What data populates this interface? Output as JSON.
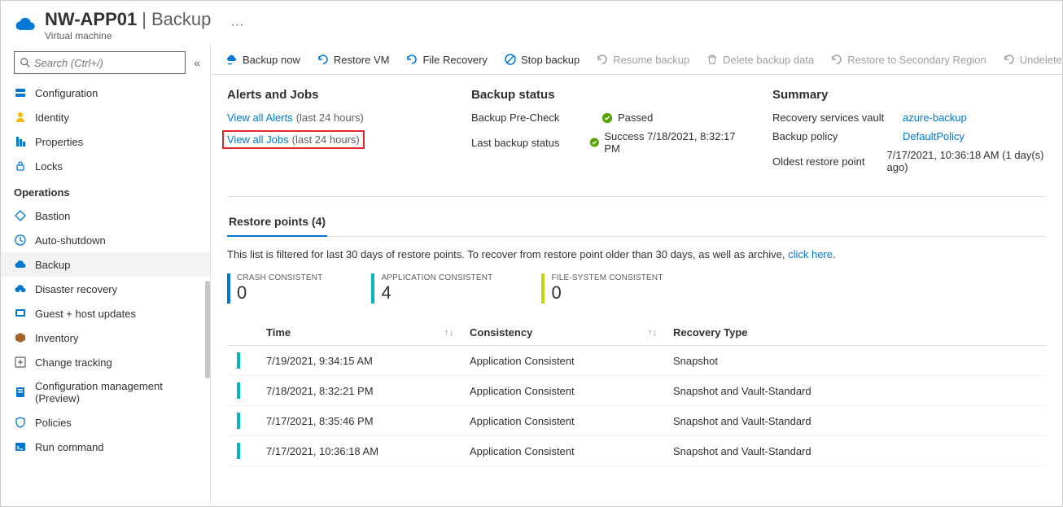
{
  "header": {
    "vm_name": "NW-APP01",
    "section": "Backup",
    "subtitle": "Virtual machine",
    "more": "···"
  },
  "sidebar": {
    "search_placeholder": "Search (Ctrl+/)",
    "items1": [
      {
        "label": "Configuration"
      },
      {
        "label": "Identity"
      },
      {
        "label": "Properties"
      },
      {
        "label": "Locks"
      }
    ],
    "section_label": "Operations",
    "items2": [
      {
        "label": "Bastion"
      },
      {
        "label": "Auto-shutdown"
      },
      {
        "label": "Backup"
      },
      {
        "label": "Disaster recovery"
      },
      {
        "label": "Guest + host updates"
      },
      {
        "label": "Inventory"
      },
      {
        "label": "Change tracking"
      },
      {
        "label": "Configuration management (Preview)"
      },
      {
        "label": "Policies"
      },
      {
        "label": "Run command"
      }
    ]
  },
  "toolbar": {
    "backup_now": "Backup now",
    "restore_vm": "Restore VM",
    "file_recovery": "File Recovery",
    "stop_backup": "Stop backup",
    "resume_backup": "Resume backup",
    "delete_backup": "Delete backup data",
    "restore_secondary": "Restore to Secondary Region",
    "undelete": "Undelete"
  },
  "alerts": {
    "title": "Alerts and Jobs",
    "view_alerts": "View all Alerts",
    "view_alerts_suffix": "(last 24 hours)",
    "view_jobs": "View all Jobs",
    "view_jobs_suffix": "(last 24 hours)"
  },
  "backup_status": {
    "title": "Backup status",
    "precheck_label": "Backup Pre-Check",
    "precheck_value": "Passed",
    "last_label": "Last backup status",
    "last_value": "Success 7/18/2021, 8:32:17 PM"
  },
  "summary": {
    "title": "Summary",
    "vault_label": "Recovery services vault",
    "vault_value": "azure-backup",
    "policy_label": "Backup policy",
    "policy_value": "DefaultPolicy",
    "oldest_label": "Oldest restore point",
    "oldest_value": "7/17/2021, 10:36:18 AM (1 day(s) ago)"
  },
  "restore": {
    "tab_label": "Restore points (4)",
    "filter_text": "This list is filtered for last 30 days of restore points. To recover from restore point older than 30 days, as well as archive, ",
    "filter_link": "click here",
    "filter_suffix": ".",
    "stats": {
      "crash_label": "CRASH CONSISTENT",
      "crash_value": "0",
      "app_label": "APPLICATION CONSISTENT",
      "app_value": "4",
      "fs_label": "FILE-SYSTEM CONSISTENT",
      "fs_value": "0"
    },
    "columns": {
      "time": "Time",
      "consistency": "Consistency",
      "recovery": "Recovery Type"
    },
    "rows": [
      {
        "time": "7/19/2021, 9:34:15 AM",
        "consistency": "Application Consistent",
        "recovery": "Snapshot"
      },
      {
        "time": "7/18/2021, 8:32:21 PM",
        "consistency": "Application Consistent",
        "recovery": "Snapshot and Vault-Standard"
      },
      {
        "time": "7/17/2021, 8:35:46 PM",
        "consistency": "Application Consistent",
        "recovery": "Snapshot and Vault-Standard"
      },
      {
        "time": "7/17/2021, 10:36:18 AM",
        "consistency": "Application Consistent",
        "recovery": "Snapshot and Vault-Standard"
      }
    ]
  }
}
